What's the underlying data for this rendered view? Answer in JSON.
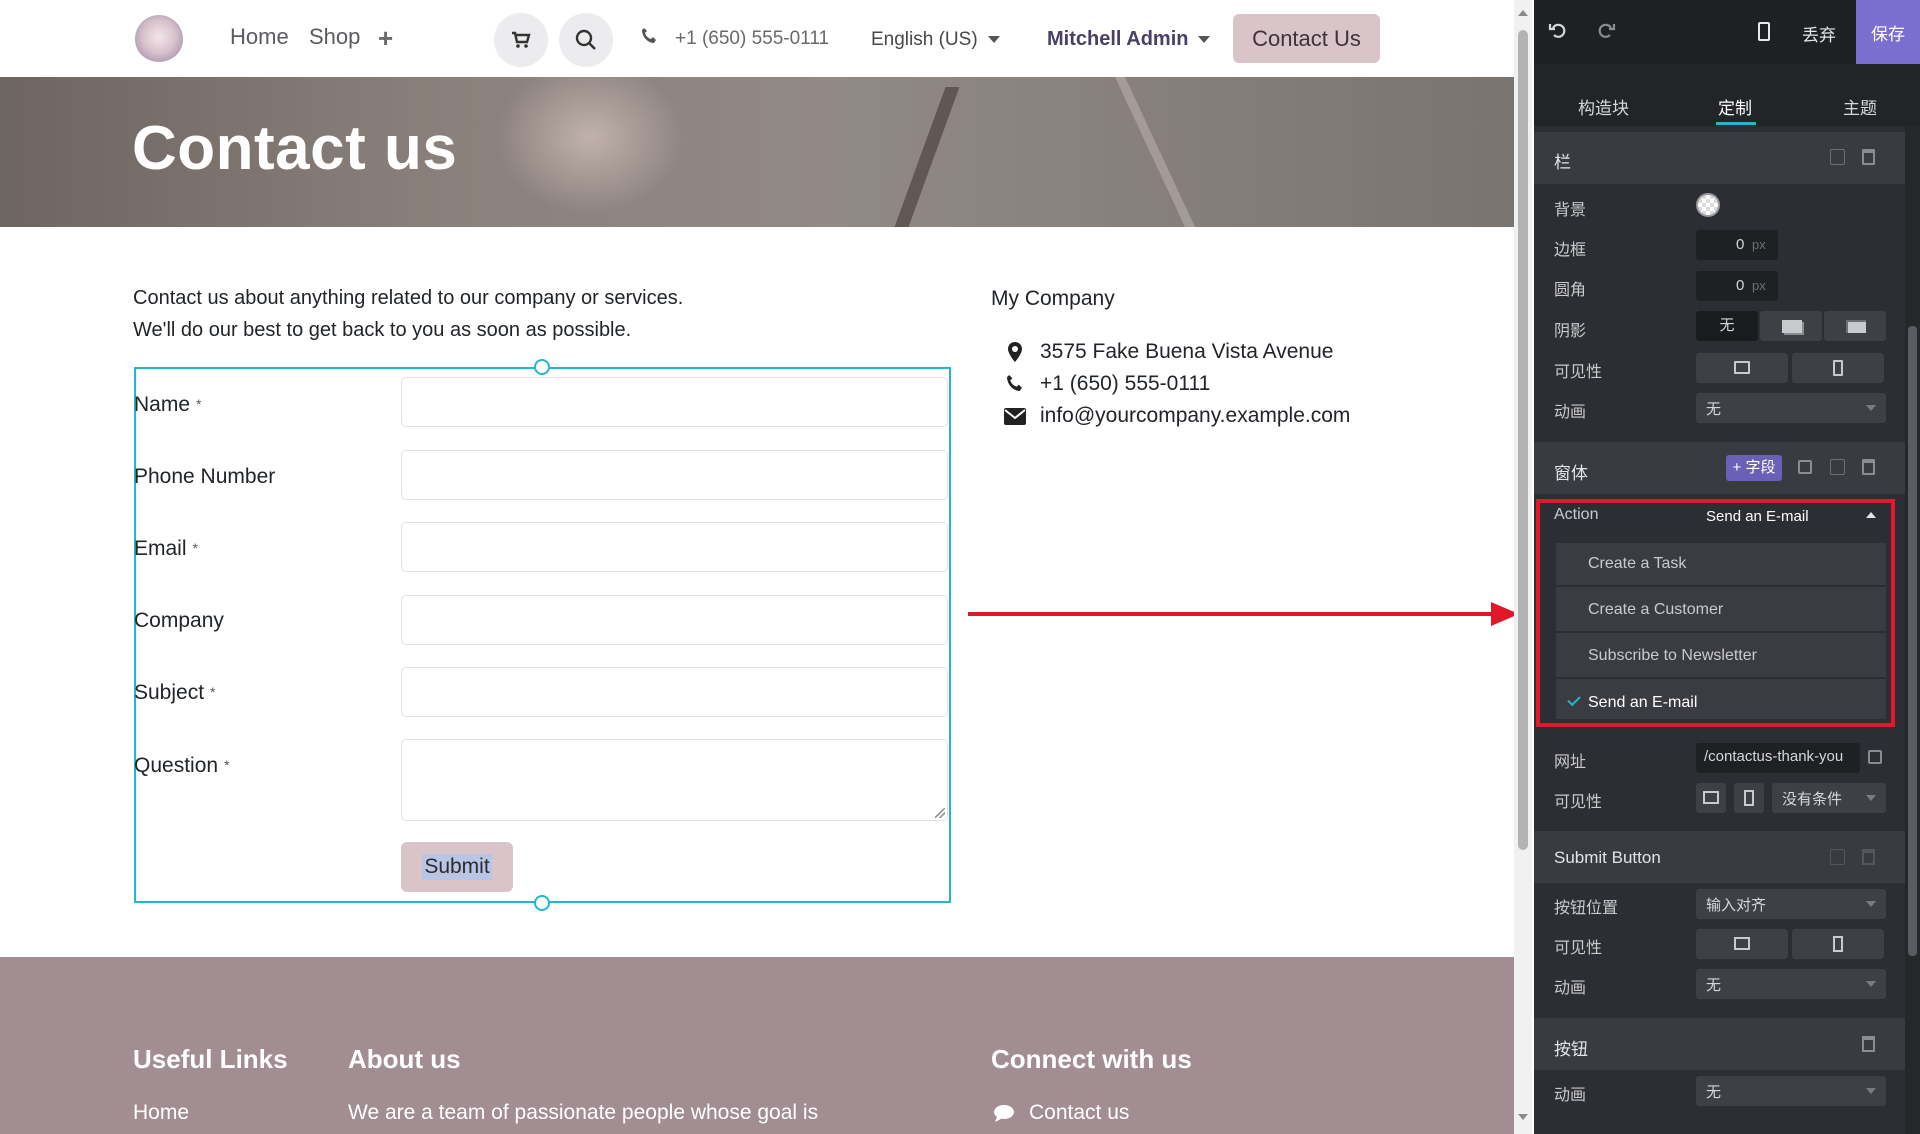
{
  "nav": {
    "items": [
      "Home",
      "Shop"
    ],
    "phone": "+1 (650) 555-0111",
    "language": "English (US)",
    "user": "Mitchell Admin",
    "cta": "Contact Us"
  },
  "hero": {
    "title": "Contact us"
  },
  "intro": {
    "line1": "Contact us about anything related to our company or services.",
    "line2": "We'll do our best to get back to you as soon as possible."
  },
  "form": {
    "fields": [
      {
        "label": "Name",
        "required": "*"
      },
      {
        "label": "Phone Number",
        "required": ""
      },
      {
        "label": "Email",
        "required": "*"
      },
      {
        "label": "Company",
        "required": ""
      },
      {
        "label": "Subject",
        "required": "*"
      },
      {
        "label": "Question",
        "required": "*"
      }
    ],
    "submit": "Submit"
  },
  "company": {
    "name": "My Company",
    "address": "3575 Fake Buena Vista Avenue",
    "phone": "+1 (650) 555-0111",
    "email": "info@yourcompany.example.com"
  },
  "footer": {
    "useful_links": "Useful Links",
    "about": "About us",
    "connect": "Connect with us",
    "link_home": "Home",
    "about_text": "We are a team of passionate people whose goal is",
    "contact_link": "Contact us"
  },
  "editor": {
    "discard": "丢弃",
    "save": "保存",
    "tabs": [
      "构造块",
      "定制",
      "主题"
    ],
    "column": {
      "title": "栏",
      "background": "背景",
      "border": "边框",
      "border_value": "0",
      "unit": "px",
      "radius": "圆角",
      "radius_value": "0",
      "shadow": "阴影",
      "shadow_none": "无",
      "visibility": "可见性",
      "animation": "动画",
      "animation_value": "无"
    },
    "form": {
      "title": "窗体",
      "add_field": "+ 字段",
      "action_label": "Action",
      "action_value": "Send an E-mail",
      "action_options": [
        "Create a Task",
        "Create a Customer",
        "Subscribe to Newsletter",
        "Send an E-mail"
      ],
      "url_label": "网址",
      "url_value": "/contactus-thank-you",
      "visibility": "可见性",
      "visibility_value": "没有条件"
    },
    "submit_button": {
      "title": "Submit Button",
      "position": "按钮位置",
      "position_value": "输入对齐",
      "visibility": "可见性",
      "animation": "动画",
      "animation_value": "无"
    },
    "button": {
      "title": "按钮",
      "animation": "动画",
      "animation_value": "无"
    }
  },
  "colors": {
    "accent": "#1fb8cc",
    "cta": "#d9c4ca",
    "footer": "#a18d92",
    "highlight": "#e0182a",
    "editor_accent": "#7c6ecf"
  }
}
